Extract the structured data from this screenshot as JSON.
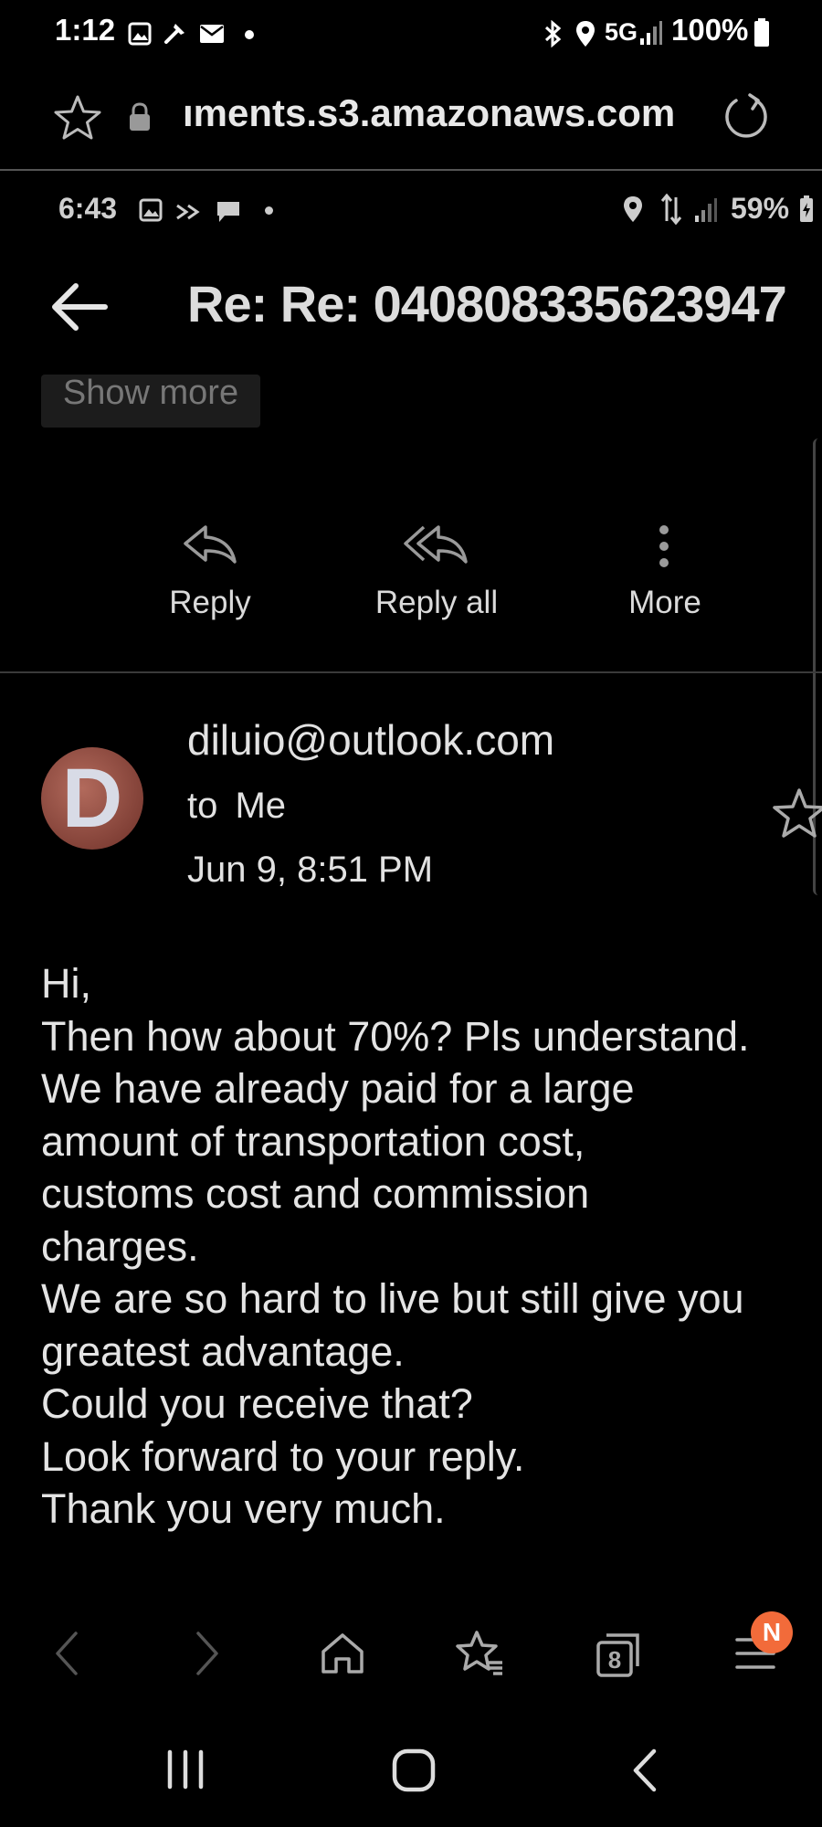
{
  "outer_status": {
    "time": "1:12",
    "network": "5G",
    "battery": "100%"
  },
  "browser": {
    "url": "ıments.s3.amazonaws.com"
  },
  "inner_status": {
    "time": "6:43",
    "battery": "59%"
  },
  "email": {
    "subject": "Re: Re: 040808335623947",
    "show_more_label": "Show more",
    "actions": {
      "reply": "Reply",
      "reply_all": "Reply all",
      "more": "More"
    },
    "sender": "diluio@outlook.com",
    "to_prefix": "to",
    "to_name": "Me",
    "date": "Jun 9, 8:51 PM",
    "avatar_letter": "D",
    "body_lines": [
      "Hi,",
      "Then how about 70%? Pls understand.",
      "We have already paid for a large",
      "amount of transportation cost,",
      "customs cost and commission",
      "charges.",
      "We are so hard to live but still give you",
      "greatest advantage.",
      "Could you receive that?",
      "Look forward to your reply.",
      "Thank you very much."
    ]
  },
  "browser_toolbar": {
    "tabs_count": "8",
    "menu_badge": "N"
  },
  "colors": {
    "background": "#000000",
    "badge": "#f26b3a",
    "text": "#e4e4e4"
  }
}
